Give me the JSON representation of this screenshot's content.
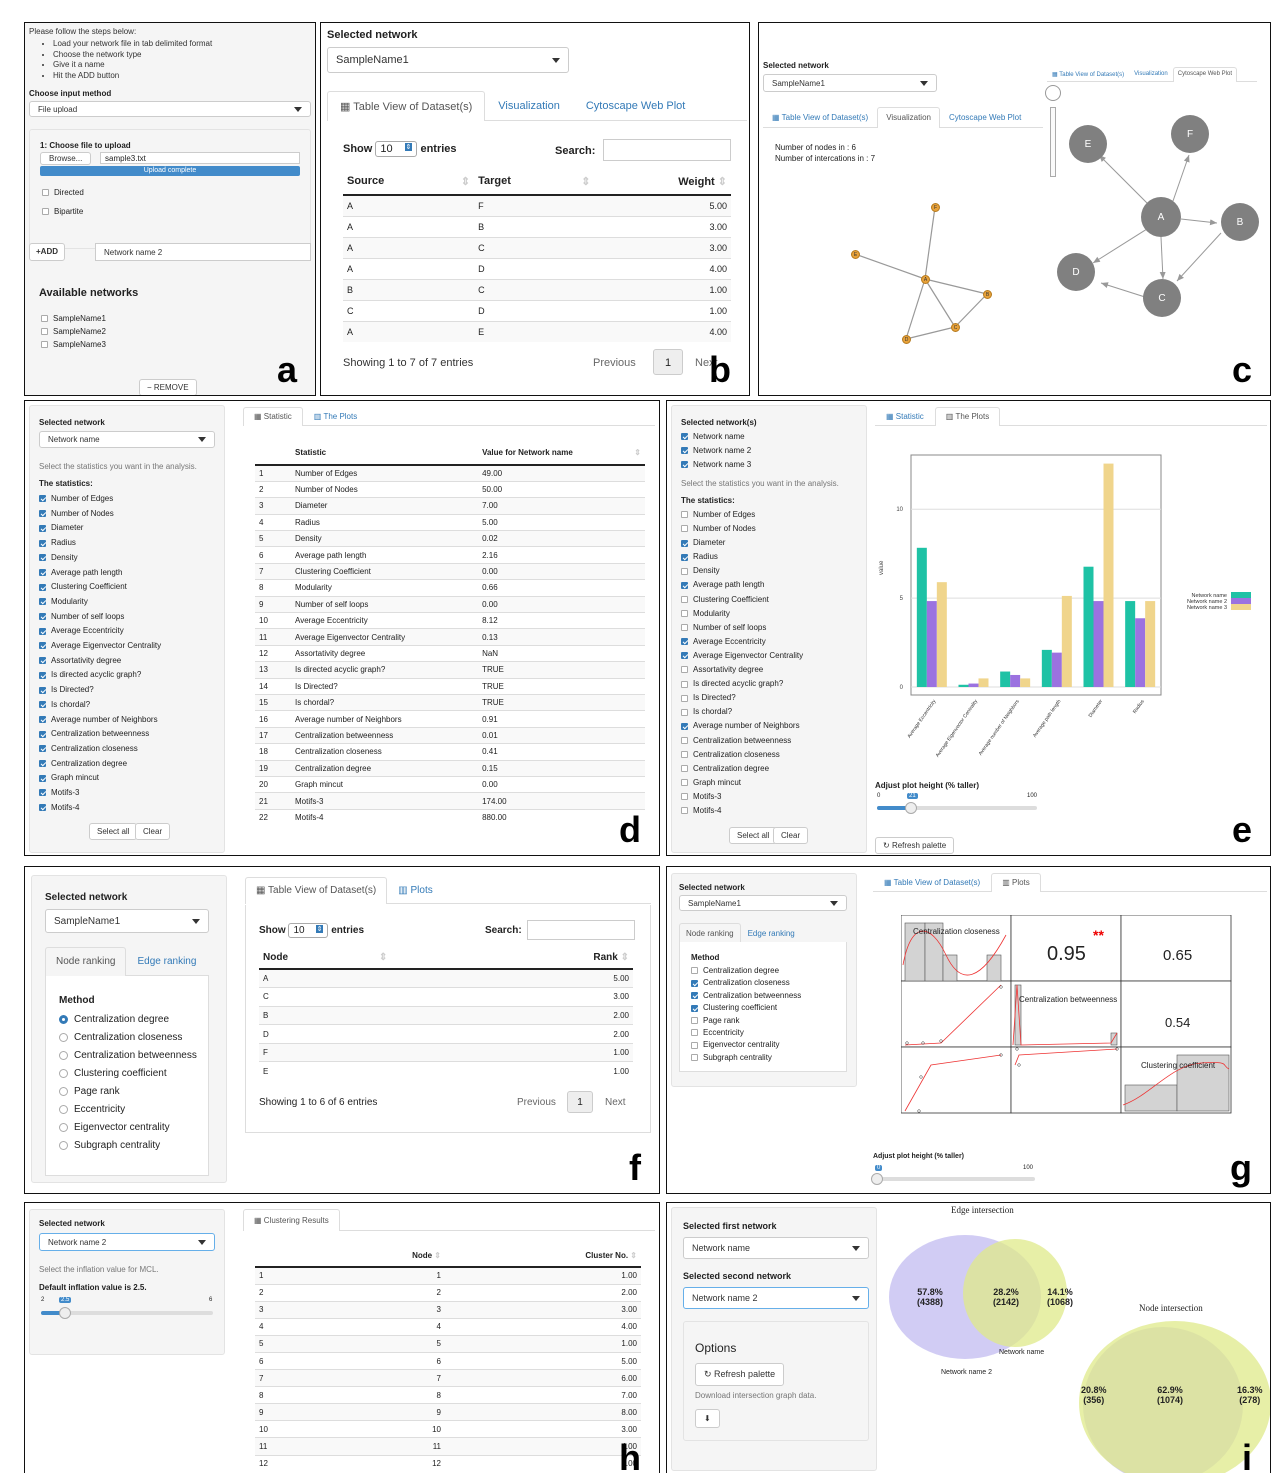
{
  "a": {
    "intro": "Please follow the steps below:",
    "steps": [
      "Load your network file in tab delimited format",
      "Choose the network type",
      "Give it a name",
      "Hit the ADD button"
    ],
    "input_method_label": "Choose input method",
    "input_method": "File upload",
    "file_label": "1: Choose file to upload",
    "browse": "Browse...",
    "filename": "sample3.txt",
    "upload_status": "Upload complete",
    "directed": "Directed",
    "bipartite": "Bipartite",
    "add": "ADD",
    "name_value": "Network name 2",
    "available_title": "Available networks",
    "networks": [
      "SampleName1",
      "SampleName2",
      "SampleName3"
    ],
    "remove": "REMOVE",
    "letter": "a"
  },
  "b": {
    "selected_label": "Selected network",
    "selected": "SampleName1",
    "tabs": [
      "Table View of Dataset(s)",
      "Visualization",
      "Cytoscape Web Plot"
    ],
    "show": "Show",
    "entries_value": "10",
    "entries": "entries",
    "search": "Search:",
    "columns": [
      "Source",
      "Target",
      "Weight"
    ],
    "rows": [
      [
        "A",
        "F",
        "5.00"
      ],
      [
        "A",
        "B",
        "3.00"
      ],
      [
        "A",
        "C",
        "3.00"
      ],
      [
        "A",
        "D",
        "4.00"
      ],
      [
        "B",
        "C",
        "1.00"
      ],
      [
        "C",
        "D",
        "1.00"
      ],
      [
        "A",
        "E",
        "4.00"
      ]
    ],
    "footer": "Showing 1 to 7 of 7 entries",
    "previous": "Previous",
    "page": "1",
    "next": "Next",
    "letter": "b"
  },
  "c": {
    "selected_label": "Selected network",
    "selected": "SampleName1",
    "tabs": [
      "Table View of Dataset(s)",
      "Visualization",
      "Cytoscape Web Plot"
    ],
    "nodes_text": "Number of nodes in : 6",
    "edges_text": "Number of intercations in : 7",
    "mini_tabs": [
      "Table View of Dataset(s)",
      "Visualization",
      "Cytoscape Web Plot"
    ],
    "small_nodes": [
      "F",
      "E",
      "A",
      "B",
      "C",
      "D"
    ],
    "big_nodes": [
      "E",
      "F",
      "A",
      "B",
      "D",
      "C"
    ],
    "letter": "c"
  },
  "d": {
    "selected_label": "Selected network",
    "selected": "Network name",
    "hint": "Select the statistics you want in the analysis.",
    "stats_label": "The statistics:",
    "stats": [
      "Number of Edges",
      "Number of Nodes",
      "Diameter",
      "Radius",
      "Density",
      "Average path length",
      "Clustering Coefficient",
      "Modularity",
      "Number of self loops",
      "Average Eccentricity",
      "Average Eigenvector Centrality",
      "Assortativity degree",
      "Is directed acyclic graph?",
      "Is Directed?",
      "Is chordal?",
      "Average number of Neighbors",
      "Centralization betweenness",
      "Centralization closeness",
      "Centralization degree",
      "Graph mincut",
      "Motifs-3",
      "Motifs-4"
    ],
    "select_all": "Select all",
    "clear": "Clear",
    "tabs": [
      "Statistic",
      "The Plots"
    ],
    "columns": [
      "Statistic",
      "Value for Network name"
    ],
    "values": [
      "49.00",
      "50.00",
      "7.00",
      "5.00",
      "0.02",
      "2.16",
      "0.00",
      "0.66",
      "0.00",
      "8.12",
      "0.13",
      "NaN",
      "TRUE",
      "TRUE",
      "TRUE",
      "0.91",
      "0.01",
      "0.41",
      "0.15",
      "0.00",
      "174.00",
      "880.00"
    ],
    "letter": "d"
  },
  "e": {
    "selected_label": "Selected network(s)",
    "networks": [
      "Network name",
      "Network name 2",
      "Network name 3"
    ],
    "hint": "Select the statistics you want in the analysis.",
    "stats_label": "The statistics:",
    "checked": [
      false,
      false,
      true,
      true,
      false,
      true,
      false,
      false,
      false,
      true,
      true,
      false,
      false,
      false,
      false,
      true,
      false,
      false,
      false,
      false,
      false,
      false
    ],
    "select_all": "Select all",
    "clear": "Clear",
    "tabs": [
      "Statistic",
      "The Plots"
    ],
    "height_label": "Adjust plot height (% taller)",
    "slider_min": "0",
    "slider_value": "21",
    "slider_max": "100",
    "refresh": "Refresh palette",
    "letter": "e"
  },
  "chart_data": [
    {
      "type": "bar",
      "ylabel": "value",
      "categories": [
        "Average Eccentricity",
        "Average Eigenvector Centrality",
        "Average number of Neighbors",
        "Average path length",
        "Diameter",
        "Radius"
      ],
      "yticks": [
        "0",
        "5",
        "10"
      ],
      "ylim": [
        0,
        13.5
      ],
      "series": [
        {
          "name": "Network name",
          "color": "#1ec2a5",
          "values": [
            8.1,
            0.13,
            0.9,
            2.16,
            7,
            5
          ]
        },
        {
          "name": "Network name 2",
          "color": "#9b72e0",
          "values": [
            5,
            0.2,
            0.7,
            2,
            5,
            4
          ]
        },
        {
          "name": "Network name 3",
          "color": "#f0d58c",
          "values": [
            6.1,
            0.5,
            0.5,
            5.3,
            13,
            5
          ]
        }
      ],
      "legend": "right"
    },
    {
      "type": "scatter",
      "variables": [
        "Centralization closeness",
        "Centralization betweenness",
        "Clustering coefficient"
      ],
      "correlations": [
        {
          "pair": "closeness-betweenness",
          "value": "0.95",
          "stars": "**"
        },
        {
          "pair": "closeness-clustering",
          "value": "0.65"
        },
        {
          "pair": "betweenness-clustering",
          "value": "0.54"
        }
      ]
    }
  ],
  "f": {
    "selected_label": "Selected network",
    "selected": "SampleName1",
    "subtabs": [
      "Node ranking",
      "Edge ranking"
    ],
    "method_label": "Method",
    "methods": [
      "Centralization degree",
      "Centralization closeness",
      "Centralization betweenness",
      "Clustering coefficient",
      "Page rank",
      "Eccentricity",
      "Eigenvector centrality",
      "Subgraph centrality"
    ],
    "tabs": [
      "Table View of Dataset(s)",
      "Plots"
    ],
    "show": "Show",
    "entries_value": "10",
    "entries": "entries",
    "search": "Search:",
    "columns": [
      "Node",
      "Rank"
    ],
    "rows": [
      [
        "A",
        "5.00"
      ],
      [
        "C",
        "3.00"
      ],
      [
        "B",
        "2.00"
      ],
      [
        "D",
        "2.00"
      ],
      [
        "F",
        "1.00"
      ],
      [
        "E",
        "1.00"
      ]
    ],
    "footer": "Showing 1 to 6 of 6 entries",
    "previous": "Previous",
    "page": "1",
    "next": "Next",
    "letter": "f"
  },
  "g": {
    "selected_label": "Selected network",
    "selected": "SampleName1",
    "subtabs": [
      "Node ranking",
      "Edge ranking"
    ],
    "method_label": "Method",
    "checked": [
      false,
      true,
      true,
      true,
      false,
      false,
      false,
      false
    ],
    "tabs": [
      "Table View of Dataset(s)",
      "Plots"
    ],
    "height_label": "Adjust plot height (% taller)",
    "slider_value": "0",
    "slider_max": "100",
    "letter": "g"
  },
  "h": {
    "selected_label": "Selected network",
    "selected": "Network name 2",
    "hint": "Select the inflation value for MCL.",
    "default_label": "Default inflation value is 2.5.",
    "slider_min": "2",
    "slider_value": "2.5",
    "slider_max": "6",
    "tab": "Clustering Results",
    "columns": [
      "Node",
      "Cluster No."
    ],
    "rows": [
      [
        "1",
        "1",
        "1.00"
      ],
      [
        "2",
        "2",
        "2.00"
      ],
      [
        "3",
        "3",
        "3.00"
      ],
      [
        "4",
        "4",
        "4.00"
      ],
      [
        "5",
        "5",
        "1.00"
      ],
      [
        "6",
        "6",
        "5.00"
      ],
      [
        "7",
        "7",
        "6.00"
      ],
      [
        "8",
        "8",
        "7.00"
      ],
      [
        "9",
        "9",
        "8.00"
      ],
      [
        "10",
        "10",
        "3.00"
      ],
      [
        "11",
        "11",
        "4.00"
      ],
      [
        "12",
        "12",
        "4.00"
      ]
    ],
    "letter": "h"
  },
  "i": {
    "first_label": "Selected first network",
    "first": "Network name",
    "second_label": "Selected second network",
    "second": "Network name 2",
    "options_label": "Options",
    "refresh": "Refresh palette",
    "download_text": "Download intersection graph data.",
    "edge_title": "Edge intersection",
    "edge_left_pct": "57.8%",
    "edge_left_n": "(4388)",
    "edge_mid_pct": "28.2%",
    "edge_mid_n": "(2142)",
    "edge_right_pct": "14.1%",
    "edge_right_n": "(1068)",
    "edge_label_a": "Network name",
    "edge_label_b": "Network name 2",
    "node_title": "Node intersection",
    "node_left_pct": "20.8%",
    "node_left_n": "(356)",
    "node_mid_pct": "62.9%",
    "node_mid_n": "(1074)",
    "node_right_pct": "16.3%",
    "node_right_n": "(278)",
    "letter": "i"
  }
}
